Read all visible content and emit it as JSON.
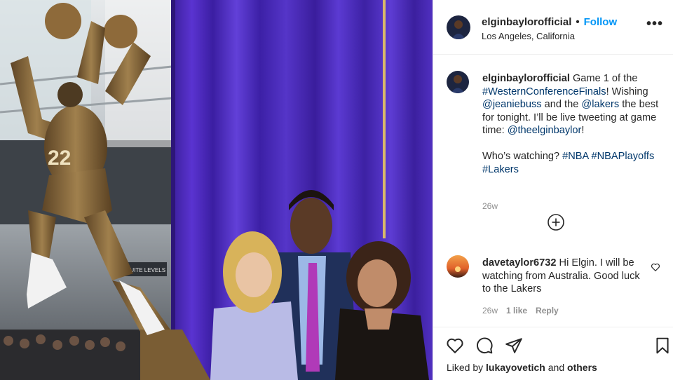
{
  "post": {
    "username": "elginbaylorofficial",
    "separator": "•",
    "follow_label": "Follow",
    "location": "Los Angeles, California",
    "more_icon": "more-horizontal-icon",
    "more_label": "•••"
  },
  "caption": {
    "username": "elginbaylorofficial",
    "parts": {
      "p1": "Game 1 of the",
      "tag1": "#WesternConferenceFinals",
      "p2": "! Wishing",
      "tag2": "@jeaniebuss",
      "p3": "and the",
      "tag3": "@lakers",
      "p4": "the best for tonight. I’ll be live tweeting at game time:",
      "tag4": "@theelginbaylor",
      "p5": "!",
      "p6": "Who’s watching?",
      "tag5": "#NBA",
      "tag6": "#NBAPlayoffs",
      "tag7": "#Lakers"
    },
    "time": "26w"
  },
  "load_more_icon": "plus-circle-icon",
  "comment": {
    "username": "davetaylor6732",
    "text": "Hi Elgin. I will be watching from Australia. Good luck to the Lakers",
    "time": "26w",
    "likes": "1 like",
    "reply_label": "Reply",
    "like_icon": "heart-outline-icon"
  },
  "actions": {
    "icons": [
      "heart-icon",
      "comment-icon",
      "share-icon",
      "bookmark-icon"
    ],
    "liked_by_prefix": "Liked by",
    "liked_by_user": "lukayovetich",
    "liked_by_and": "and",
    "liked_by_others": "others"
  },
  "photo": {
    "statue_jersey_number": "22",
    "sign_text": "SUITE LEVELS"
  },
  "colors": {
    "link": "#00376b",
    "follow": "#0095f6",
    "muted": "#8e8e8e",
    "curtain": "#4a23b8",
    "bronze": "#8a6a3c"
  }
}
